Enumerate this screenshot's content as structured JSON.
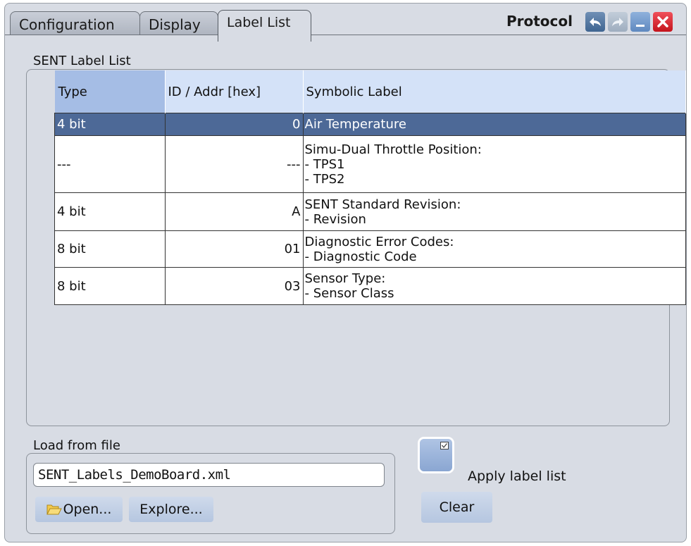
{
  "header": {
    "title": "Protocol",
    "tabs": [
      {
        "label": "Configuration"
      },
      {
        "label": "Display"
      },
      {
        "label": "Label List"
      }
    ]
  },
  "label_list": {
    "group_title": "SENT Label List",
    "columns": [
      "Type",
      "ID / Addr [hex]",
      "Symbolic Label"
    ],
    "rows": [
      {
        "type": "4 bit",
        "id": "0",
        "label": "Air Temperature",
        "selected": true
      },
      {
        "type": "---",
        "id": "---",
        "label": "Simu-Dual Throttle Position:\n- TPS1\n- TPS2",
        "selected": false
      },
      {
        "type": "4 bit",
        "id": "A",
        "label": "SENT Standard Revision:\n- Revision",
        "selected": false
      },
      {
        "type": "8 bit",
        "id": "01",
        "label": "Diagnostic Error Codes:\n- Diagnostic Code",
        "selected": false
      },
      {
        "type": "8 bit",
        "id": "03",
        "label": "Sensor Type:\n- Sensor Class",
        "selected": false
      }
    ]
  },
  "load_file": {
    "group_title": "Load from file",
    "file_value": "SENT_Labels_DemoBoard.xml",
    "open_label": "Open...",
    "explore_label": "Explore..."
  },
  "apply": {
    "label": "Apply label list",
    "checked": false
  },
  "clear_label": "Clear",
  "colors": {
    "selected_row": "#4d6997",
    "header_type": "#a5bde5",
    "header": "#d4e2f8",
    "panel": "#d8dce4"
  }
}
